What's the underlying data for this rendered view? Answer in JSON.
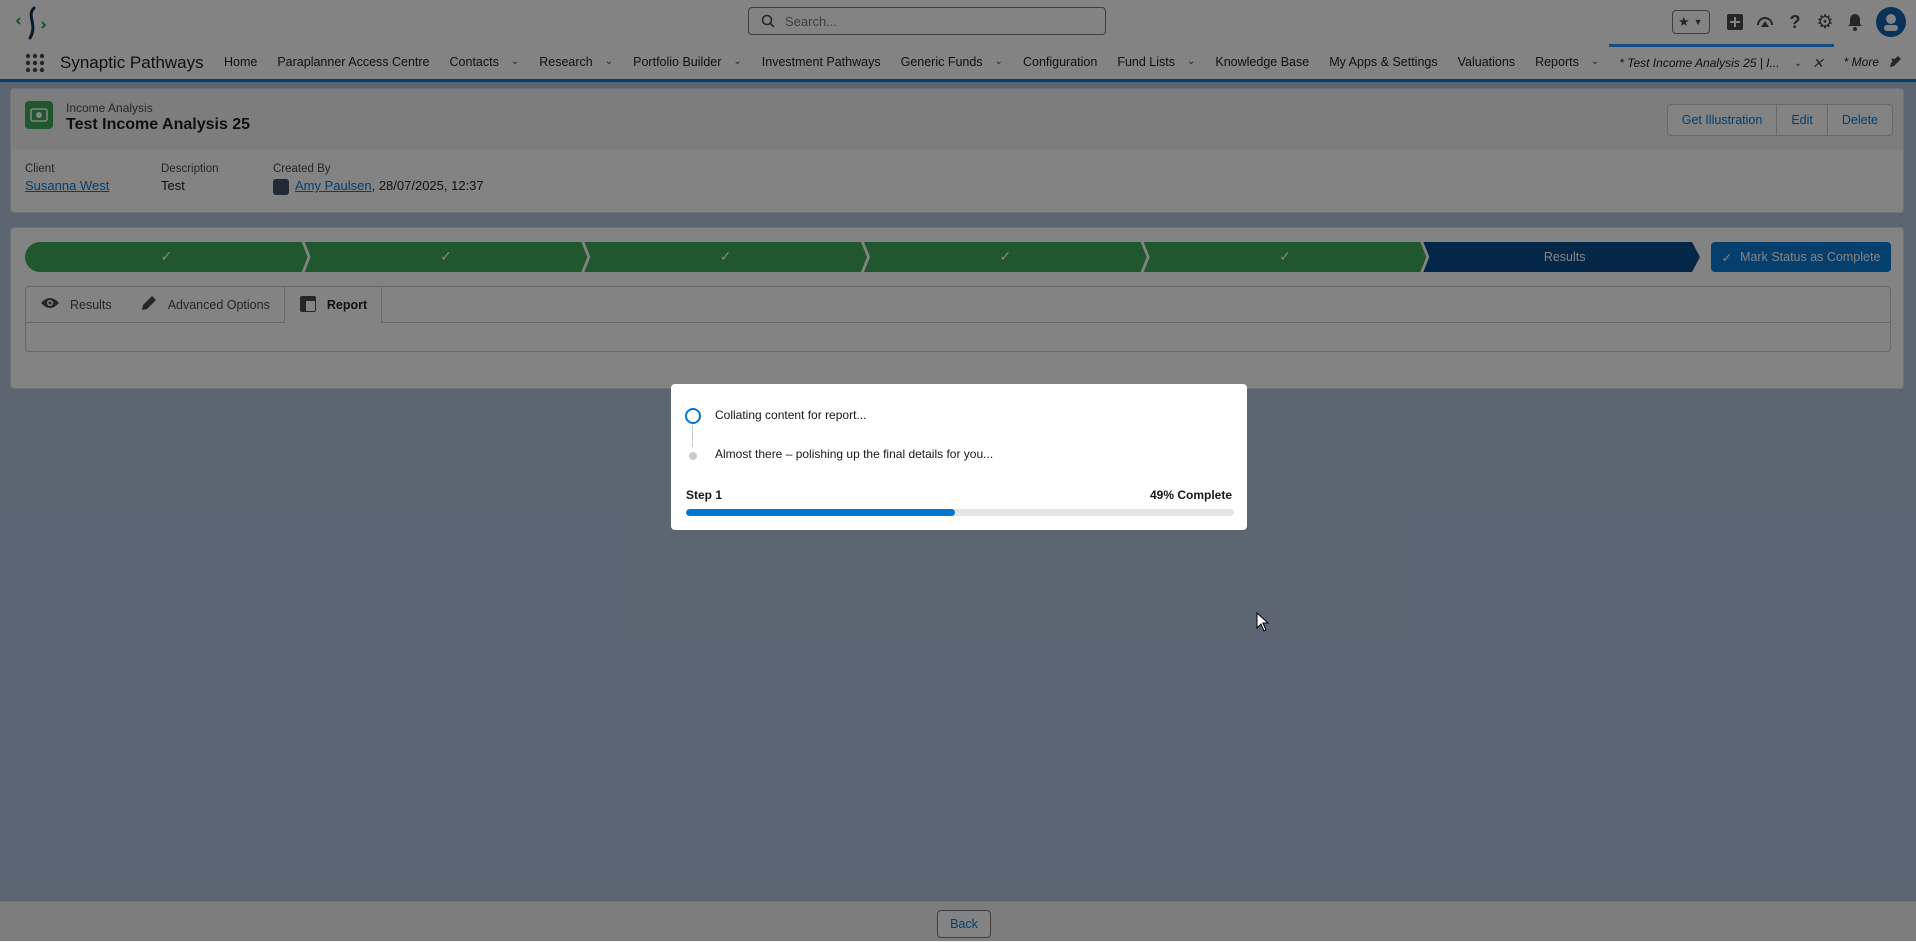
{
  "header": {
    "search_placeholder": "Search...",
    "icons": [
      "favorites-star-icon",
      "add-icon",
      "trailhead-icon",
      "help-icon",
      "setup-gear-icon",
      "notifications-bell-icon",
      "user-avatar"
    ]
  },
  "nav": {
    "app_name": "Synaptic Pathways",
    "items": [
      {
        "label": "Home",
        "has_menu": false
      },
      {
        "label": "Paraplanner Access Centre",
        "has_menu": false
      },
      {
        "label": "Contacts",
        "has_menu": true
      },
      {
        "label": "Research",
        "has_menu": true
      },
      {
        "label": "Portfolio Builder",
        "has_menu": true
      },
      {
        "label": "Investment Pathways",
        "has_menu": false
      },
      {
        "label": "Generic Funds",
        "has_menu": true
      },
      {
        "label": "Configuration",
        "has_menu": false
      },
      {
        "label": "Fund Lists",
        "has_menu": true
      },
      {
        "label": "Knowledge Base",
        "has_menu": false
      },
      {
        "label": "My Apps & Settings",
        "has_menu": false
      },
      {
        "label": "Valuations",
        "has_menu": false
      },
      {
        "label": "Reports",
        "has_menu": true
      }
    ],
    "active_tab": "* Test Income Analysis 25 | I...",
    "more": "* More"
  },
  "record": {
    "type": "Income Analysis",
    "title": "Test Income Analysis 25",
    "buttons": [
      "Get Illustration",
      "Edit",
      "Delete"
    ],
    "fields": {
      "client_label": "Client",
      "client_value": "Susanna West",
      "description_label": "Description",
      "description_value": "Test",
      "created_by_label": "Created By",
      "created_by_name": "Amy Paulsen",
      "created_by_date": ", 28/07/2025, 12:37"
    }
  },
  "path": {
    "completed_steps": 5,
    "current_step": "Results",
    "mark_complete": "Mark Status as Complete",
    "colors": {
      "complete": "#3ba755",
      "current": "#014486"
    }
  },
  "tabs": [
    {
      "label": "Results",
      "icon": "eye-icon",
      "active": false
    },
    {
      "label": "Advanced Options",
      "icon": "pencil-icon",
      "active": false
    },
    {
      "label": "Report",
      "icon": "report-table-icon",
      "active": true
    }
  ],
  "footer": {
    "back": "Back"
  },
  "modal": {
    "steps": [
      {
        "text": "Collating content for report...",
        "state": "active"
      },
      {
        "text": "Almost there – polishing up the final details for you...",
        "state": "pending"
      }
    ],
    "progress_label": "Step 1",
    "progress_text": "49% Complete",
    "progress_fraction": 0.49
  }
}
